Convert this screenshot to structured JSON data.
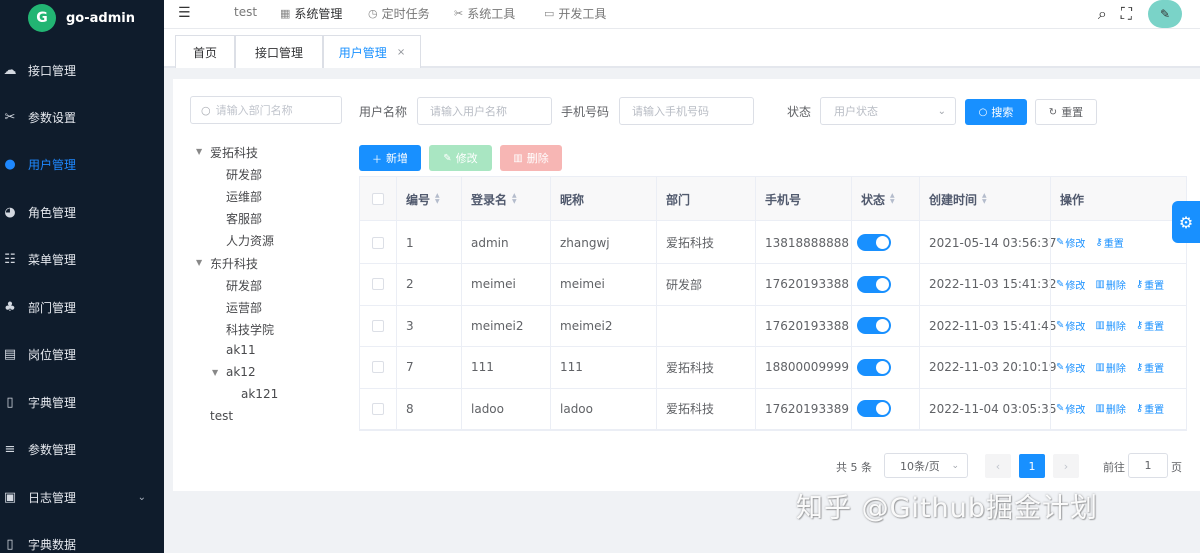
{
  "app": {
    "name": "go-admin",
    "logo_letter": "G"
  },
  "sidebar": {
    "items": [
      {
        "label": "接口管理",
        "icon": "cloud-icon"
      },
      {
        "label": "参数设置",
        "icon": "tools-icon"
      },
      {
        "label": "用户管理",
        "icon": "user-icon",
        "active": true
      },
      {
        "label": "角色管理",
        "icon": "users-icon"
      },
      {
        "label": "菜单管理",
        "icon": "list-icon"
      },
      {
        "label": "部门管理",
        "icon": "tree-icon"
      },
      {
        "label": "岗位管理",
        "icon": "chart-icon"
      },
      {
        "label": "字典管理",
        "icon": "book-icon"
      },
      {
        "label": "参数管理",
        "icon": "sliders-icon"
      },
      {
        "label": "日志管理",
        "icon": "log-icon",
        "expandable": true
      },
      {
        "label": "字典数据",
        "icon": "book-icon"
      }
    ]
  },
  "topnav": {
    "items": [
      {
        "label": "test",
        "icon": ""
      },
      {
        "label": "系统管理",
        "icon": "grid-icon",
        "active": true
      },
      {
        "label": "定时任务",
        "icon": "clock-icon"
      },
      {
        "label": "系统工具",
        "icon": "tools-icon"
      },
      {
        "label": "开发工具",
        "icon": "monitor-icon"
      }
    ]
  },
  "tabs": [
    {
      "label": "首页"
    },
    {
      "label": "接口管理"
    },
    {
      "label": "用户管理",
      "active": true,
      "close": "×"
    }
  ],
  "dept": {
    "search_placeholder": "请输入部门名称",
    "tree": [
      {
        "label": "爱拓科技",
        "level": 0,
        "expanded": true
      },
      {
        "label": "研发部",
        "level": 1
      },
      {
        "label": "运维部",
        "level": 1
      },
      {
        "label": "客服部",
        "level": 1
      },
      {
        "label": "人力资源",
        "level": 1
      },
      {
        "label": "东升科技",
        "level": 0,
        "expanded": true
      },
      {
        "label": "研发部",
        "level": 1
      },
      {
        "label": "运营部",
        "level": 1
      },
      {
        "label": "科技学院",
        "level": 1
      },
      {
        "label": "ak11",
        "level": 1
      },
      {
        "label": "ak12",
        "level": 1,
        "expanded": true
      },
      {
        "label": "ak121",
        "level": 2
      },
      {
        "label": "test",
        "level": 0
      }
    ]
  },
  "filters": {
    "username_label": "用户名称",
    "username_placeholder": "请输入用户名称",
    "phone_label": "手机号码",
    "phone_placeholder": "请输入手机号码",
    "status_label": "状态",
    "status_placeholder": "用户状态",
    "search_label": "搜索",
    "reset_label": "重置"
  },
  "toolbar": {
    "add_label": "新增",
    "edit_label": "修改",
    "delete_label": "删除"
  },
  "table": {
    "headers": [
      "编号",
      "登录名",
      "昵称",
      "部门",
      "手机号",
      "状态",
      "创建时间",
      "操作"
    ],
    "rows": [
      {
        "id": "1",
        "login": "admin",
        "nick": "zhangwj",
        "dept": "爱拓科技",
        "phone": "13818888888",
        "status_on": true,
        "created": "2021-05-14 03:56:37",
        "actions": [
          "修改",
          "重置"
        ]
      },
      {
        "id": "2",
        "login": "meimei",
        "nick": "meimei",
        "dept": "研发部",
        "phone": "17620193388",
        "status_on": true,
        "created": "2022-11-03 15:41:32",
        "actions": [
          "修改",
          "删除",
          "重置"
        ]
      },
      {
        "id": "3",
        "login": "meimei2",
        "nick": "meimei2",
        "dept": "",
        "phone": "17620193388",
        "status_on": true,
        "created": "2022-11-03 15:41:45",
        "actions": [
          "修改",
          "删除",
          "重置"
        ]
      },
      {
        "id": "7",
        "login": "111",
        "nick": "111",
        "dept": "爱拓科技",
        "phone": "18800009999",
        "status_on": true,
        "created": "2022-11-03 20:10:19",
        "actions": [
          "修改",
          "删除",
          "重置"
        ]
      },
      {
        "id": "8",
        "login": "ladoo",
        "nick": "ladoo",
        "dept": "爱拓科技",
        "phone": "17620193389",
        "status_on": true,
        "created": "2022-11-04 03:05:35",
        "actions": [
          "修改",
          "删除",
          "重置"
        ]
      }
    ]
  },
  "pagination": {
    "total": "共 5 条",
    "page_size": "10条/页",
    "current_page": "1",
    "goto_label": "前往",
    "goto_value": "1",
    "page_suffix": "页"
  },
  "watermark": "知乎 @Github掘金计划",
  "colors": {
    "primary": "#1890ff",
    "sidebar_bg": "#0f1c2c",
    "success_disabled": "#a9e6c2",
    "danger_disabled": "#f7b6b4"
  }
}
